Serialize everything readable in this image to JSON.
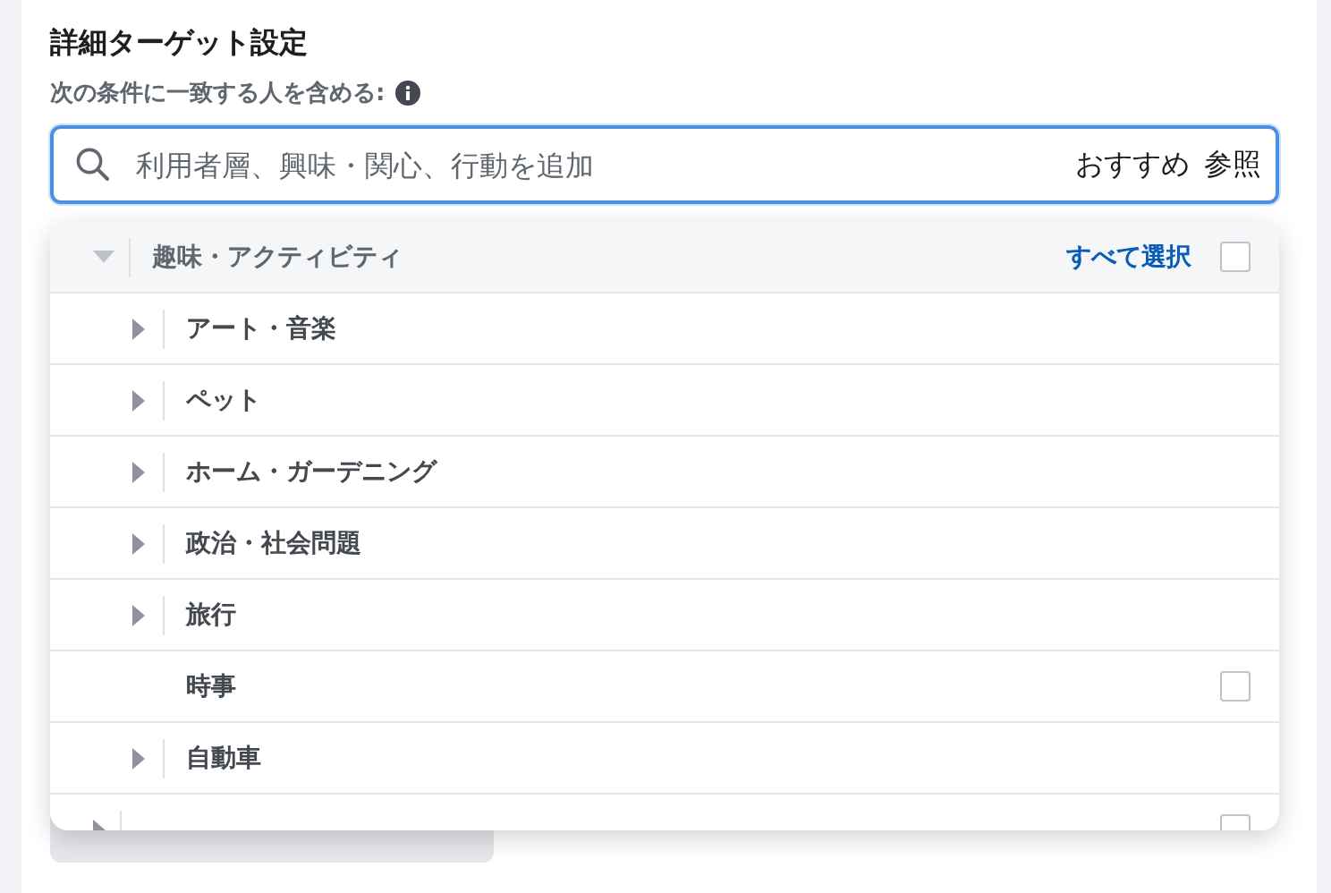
{
  "section": {
    "title": "詳細ターゲット設定",
    "subtitle": "次の条件に一致する人を含める:"
  },
  "search": {
    "placeholder": "利用者層、興味・関心、行動を追加",
    "links": [
      "おすすめ",
      "参照"
    ]
  },
  "dropdown": {
    "categories": [
      {
        "kind": "branch",
        "label": "趣味・アクティビティ",
        "expanded": true,
        "select_all": "すべて選択",
        "checked": false,
        "children": [
          {
            "kind": "branch",
            "label": "アート・音楽",
            "expanded": false
          },
          {
            "kind": "branch",
            "label": "ペット",
            "expanded": false
          },
          {
            "kind": "branch",
            "label": "ホーム・ガーデニング",
            "expanded": false
          },
          {
            "kind": "branch",
            "label": "政治・社会問題",
            "expanded": false
          },
          {
            "kind": "branch",
            "label": "旅行",
            "expanded": false
          },
          {
            "kind": "leaf",
            "label": "時事",
            "checked": false
          },
          {
            "kind": "branch",
            "label": "自動車",
            "expanded": false
          }
        ]
      },
      {
        "kind": "branch",
        "expanded": false,
        "checked": false
      }
    ]
  }
}
